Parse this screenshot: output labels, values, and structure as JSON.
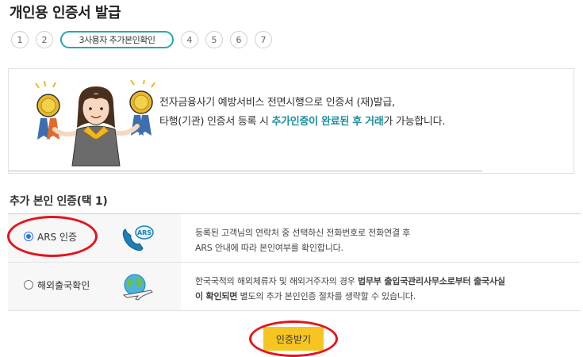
{
  "page": {
    "title": "개인용 인증서 발급"
  },
  "steps": [
    {
      "label": "1",
      "active": false
    },
    {
      "label": "2",
      "active": false
    },
    {
      "label": "3사용자 추가본인확인",
      "active": true
    },
    {
      "label": "4",
      "active": false
    },
    {
      "label": "5",
      "active": false
    },
    {
      "label": "6",
      "active": false
    },
    {
      "label": "7",
      "active": false
    }
  ],
  "notice": {
    "line1": "전자금융사기 예방서비스 전면시행으로 인증서 (재)발급,",
    "line2_before": "타행(기관) 인증서 등록 시 ",
    "line2_highlight": "추가인증이 완료된 후 거래",
    "line2_after": "가 가능합니다."
  },
  "section": {
    "title": "추가 본인 인증(택 1)"
  },
  "options": [
    {
      "label": "ARS 인증",
      "selected": true,
      "icon": "ars-phone-icon",
      "desc_line1": "등록된 고객님의 연락처 중 선택하신 전화번호로 전화연결 후",
      "desc_line2": "ARS 안내에 따라 본인여부를 확인합니다."
    },
    {
      "label": "해외출국확인",
      "selected": false,
      "icon": "globe-airplane-icon",
      "desc_line1_before": "한국국적의 해외체류자 및 해외거주자의 경우 ",
      "desc_line1_bold": "법무부 출입국관리사무소로부터 출국사실",
      "desc_line2_bold": "이 확인되면",
      "desc_line2_after": " 별도의 추가 본인인증 절차를 생략할 수 있습니다."
    }
  ],
  "confirm_button": {
    "label": "인증받기"
  },
  "colors": {
    "accent": "#2aa6a8",
    "highlight": "#1d8ea0",
    "button": "#f6c521",
    "annotation": "#e4141b"
  }
}
